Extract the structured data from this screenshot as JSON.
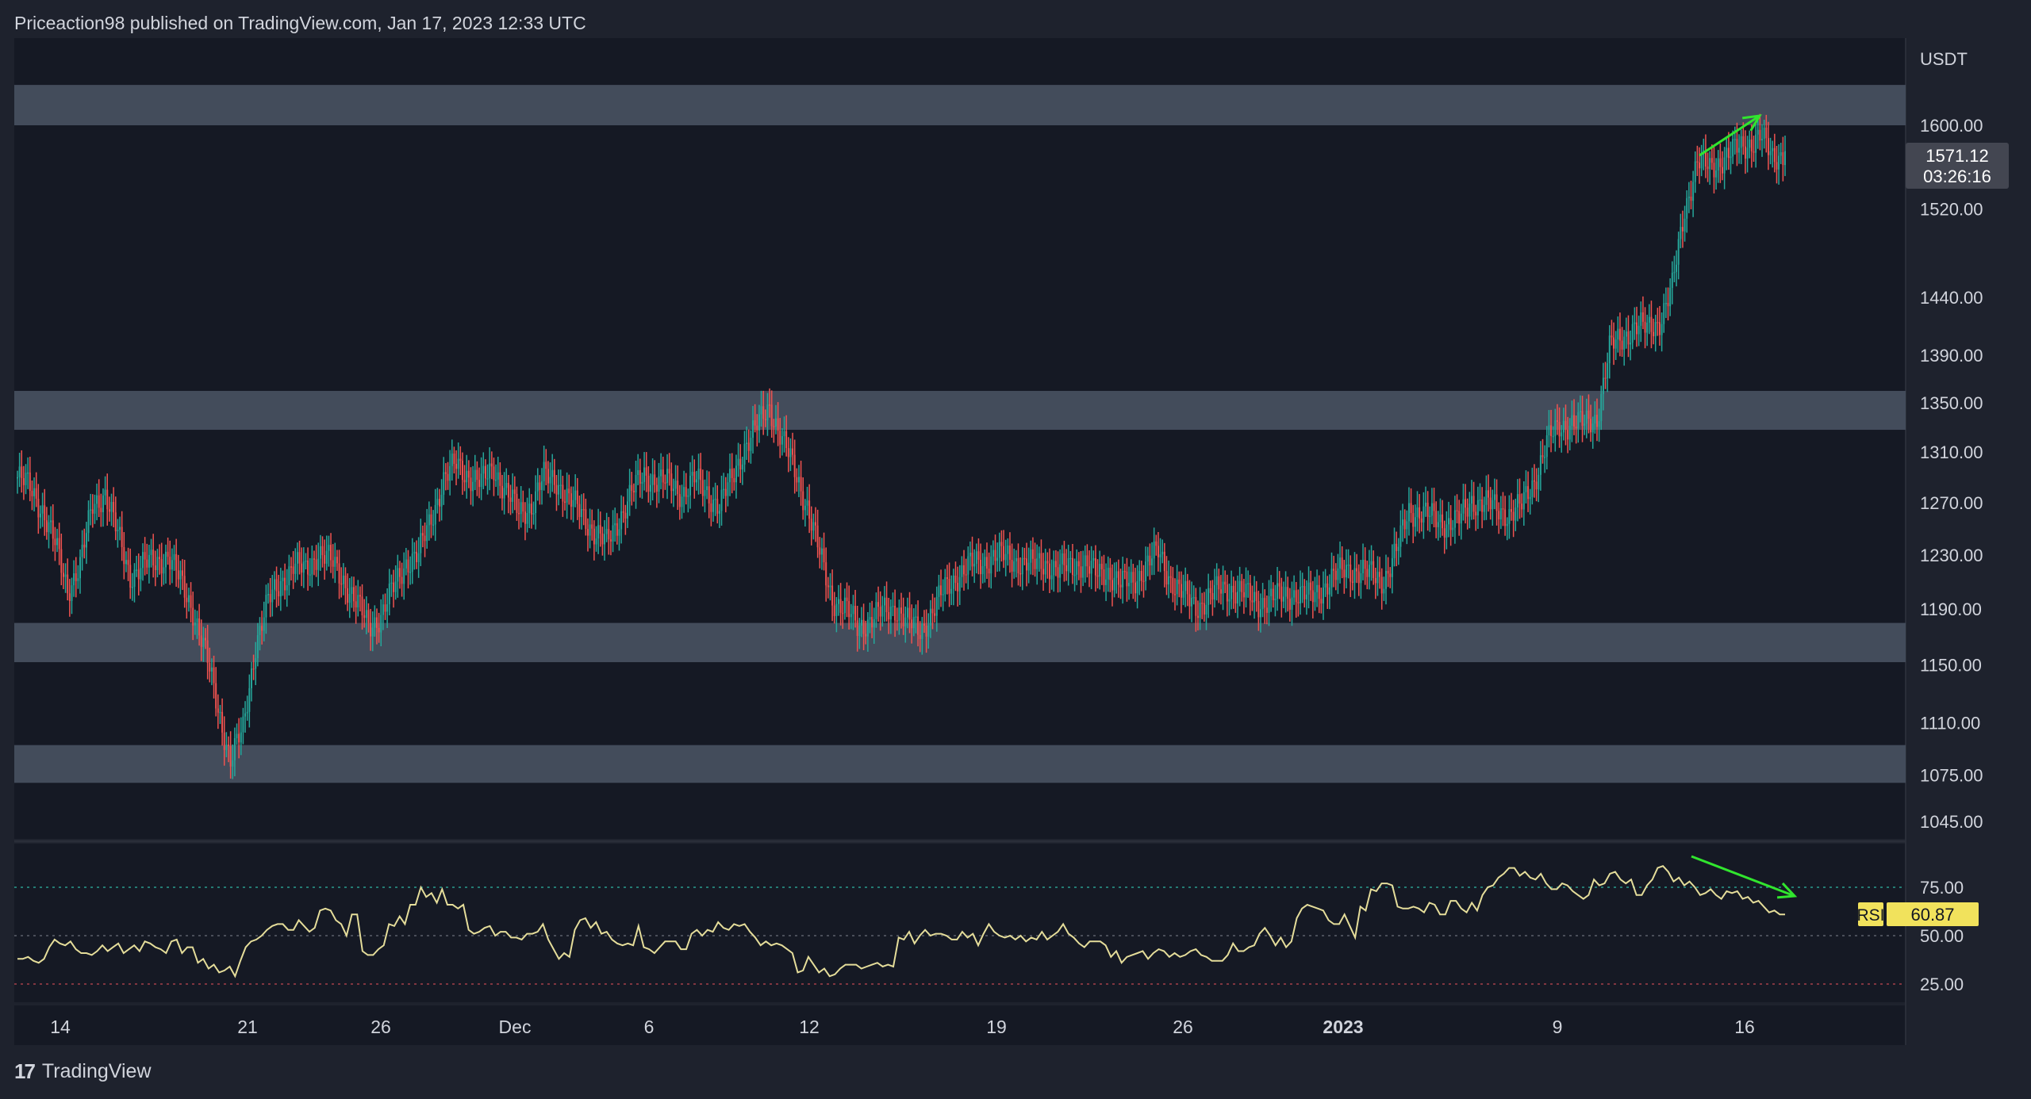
{
  "header": {
    "text": "Priceaction98 published on TradingView.com, Jan 17, 2023 12:33 UTC"
  },
  "footer": {
    "logo_mark": "17",
    "brand": "TradingView"
  },
  "colors": {
    "background": "#1e222d",
    "pane": "#151924",
    "zone": "#434c5b",
    "up": "#26a69a",
    "down": "#ef5350",
    "rsi_line": "#e5dd9a",
    "arrow": "#31e52e",
    "text": "#d1d4dc"
  },
  "price_axis": {
    "currency": "USDT",
    "ticks": [
      "1600.00",
      "1520.00",
      "1440.00",
      "1390.00",
      "1350.00",
      "1310.00",
      "1270.00",
      "1230.00",
      "1190.00",
      "1150.00",
      "1110.00",
      "1075.00",
      "1045.00"
    ],
    "last_price": "1571.12",
    "countdown": "03:26:16"
  },
  "rsi_axis": {
    "ticks": [
      "75.00",
      "50.00",
      "25.00"
    ],
    "label": "RSI",
    "value": "60.87"
  },
  "time_axis": {
    "ticks": [
      {
        "label": "14",
        "bold": false
      },
      {
        "label": "21",
        "bold": false
      },
      {
        "label": "26",
        "bold": false
      },
      {
        "label": "Dec",
        "bold": false
      },
      {
        "label": "6",
        "bold": false
      },
      {
        "label": "12",
        "bold": false
      },
      {
        "label": "19",
        "bold": false
      },
      {
        "label": "26",
        "bold": false
      },
      {
        "label": "2023",
        "bold": true
      },
      {
        "label": "9",
        "bold": false
      },
      {
        "label": "16",
        "bold": false
      }
    ]
  },
  "chart_data": {
    "type": "candlestick",
    "symbol_currency": "USDT",
    "x_dates": [
      "Nov 14",
      "Nov 21",
      "Nov 26",
      "Dec 1",
      "Dec 6",
      "Dec 12",
      "Dec 19",
      "Dec 26",
      "Jan 1 2023",
      "Jan 9",
      "Jan 16",
      "Jan 17"
    ],
    "close_path": [
      1290,
      1282,
      1265,
      1238,
      1205,
      1222,
      1268,
      1278,
      1245,
      1215,
      1222,
      1225,
      1230,
      1210,
      1190,
      1158,
      1120,
      1085,
      1105,
      1165,
      1195,
      1210,
      1222,
      1218,
      1233,
      1225,
      1212,
      1195,
      1178,
      1185,
      1205,
      1225,
      1230,
      1258,
      1288,
      1300,
      1292,
      1285,
      1298,
      1278,
      1262,
      1268,
      1290,
      1288,
      1272,
      1262,
      1248,
      1238,
      1258,
      1278,
      1292,
      1288,
      1285,
      1278,
      1288,
      1278,
      1268,
      1288,
      1315,
      1330,
      1348,
      1320,
      1295,
      1268,
      1230,
      1198,
      1190,
      1178,
      1182,
      1188,
      1192,
      1180,
      1175,
      1188,
      1205,
      1215,
      1222,
      1225,
      1230,
      1228,
      1225,
      1222,
      1225,
      1218,
      1222,
      1225,
      1215,
      1218,
      1208,
      1210,
      1222,
      1232,
      1212,
      1200,
      1192,
      1198,
      1205,
      1205,
      1200,
      1195,
      1197,
      1200,
      1202,
      1198,
      1205,
      1213,
      1220,
      1218,
      1215,
      1212,
      1232,
      1265,
      1262,
      1258,
      1255,
      1256,
      1272,
      1270,
      1265,
      1262,
      1267,
      1288,
      1318,
      1330,
      1335,
      1332,
      1338,
      1395,
      1405,
      1415,
      1412,
      1420,
      1448,
      1520,
      1565,
      1558,
      1568,
      1575,
      1582,
      1590,
      1568,
      1575
    ],
    "support_resistance_zones_usdt": [
      [
        1600,
        1640
      ],
      [
        1328,
        1360
      ],
      [
        1152,
        1180
      ],
      [
        1070,
        1095
      ]
    ],
    "rsi": {
      "overbought": 75,
      "midline": 50,
      "oversold": 25,
      "values": [
        38,
        38,
        39,
        37,
        36,
        38,
        44,
        48,
        46,
        45,
        47,
        43,
        41,
        41,
        40,
        42,
        45,
        42,
        44,
        46,
        41,
        43,
        45,
        42,
        47,
        46,
        44,
        43,
        41,
        47,
        48,
        41,
        44,
        44,
        36,
        38,
        33,
        35,
        31,
        32,
        34,
        29,
        37,
        44,
        47,
        48,
        50,
        53,
        55,
        56,
        56,
        53,
        53,
        58,
        55,
        52,
        54,
        63,
        64,
        63,
        58,
        56,
        50,
        61,
        61,
        42,
        40,
        40,
        43,
        45,
        56,
        55,
        60,
        56,
        66,
        66,
        75,
        70,
        72,
        67,
        74,
        66,
        66,
        64,
        66,
        53,
        51,
        52,
        54,
        55,
        50,
        52,
        52,
        49,
        49,
        48,
        51,
        51,
        52,
        56,
        48,
        43,
        38,
        41,
        39,
        53,
        58,
        59,
        54,
        57,
        51,
        52,
        48,
        46,
        45,
        46,
        45,
        55,
        44,
        43,
        41,
        44,
        47,
        47,
        47,
        43,
        43,
        51,
        53,
        50,
        53,
        52,
        57,
        54,
        53,
        56,
        55,
        56,
        52,
        49,
        45,
        47,
        45,
        46,
        45,
        43,
        41,
        31,
        32,
        39,
        35,
        31,
        33,
        29,
        30,
        33,
        35,
        35,
        35,
        33,
        34,
        35,
        36,
        34,
        35,
        34,
        49,
        48,
        52,
        46,
        50,
        53,
        50,
        51,
        51,
        50,
        48,
        48,
        52,
        49,
        51,
        45,
        51,
        56,
        52,
        50,
        49,
        50,
        48,
        50,
        47,
        49,
        48,
        52,
        48,
        50,
        52,
        56,
        51,
        49,
        46,
        44,
        47,
        47,
        47,
        45,
        39,
        42,
        36,
        39,
        40,
        41,
        42,
        38,
        41,
        43,
        42,
        39,
        41,
        39,
        40,
        42,
        43,
        40,
        39,
        37,
        37,
        37,
        40,
        46,
        42,
        42,
        44,
        45,
        51,
        54,
        50,
        45,
        49,
        44,
        47,
        59,
        64,
        66,
        65,
        64,
        63,
        58,
        56,
        56,
        61,
        55,
        49,
        65,
        63,
        74,
        73,
        77,
        77,
        76,
        65,
        64,
        64,
        65,
        64,
        62,
        67,
        66,
        61,
        61,
        68,
        68,
        64,
        62,
        67,
        63,
        71,
        75,
        76,
        80,
        82,
        85,
        85,
        81,
        83,
        80,
        79,
        82,
        77,
        74,
        74,
        77,
        76,
        73,
        71,
        69,
        71,
        79,
        76,
        77,
        82,
        83,
        79,
        77,
        79,
        71,
        71,
        76,
        79,
        85,
        86,
        83,
        78,
        80,
        76,
        78,
        75,
        71,
        72,
        74,
        71,
        69,
        73,
        72,
        73,
        69,
        70,
        67,
        68,
        65,
        62,
        63,
        61,
        61
      ]
    }
  }
}
